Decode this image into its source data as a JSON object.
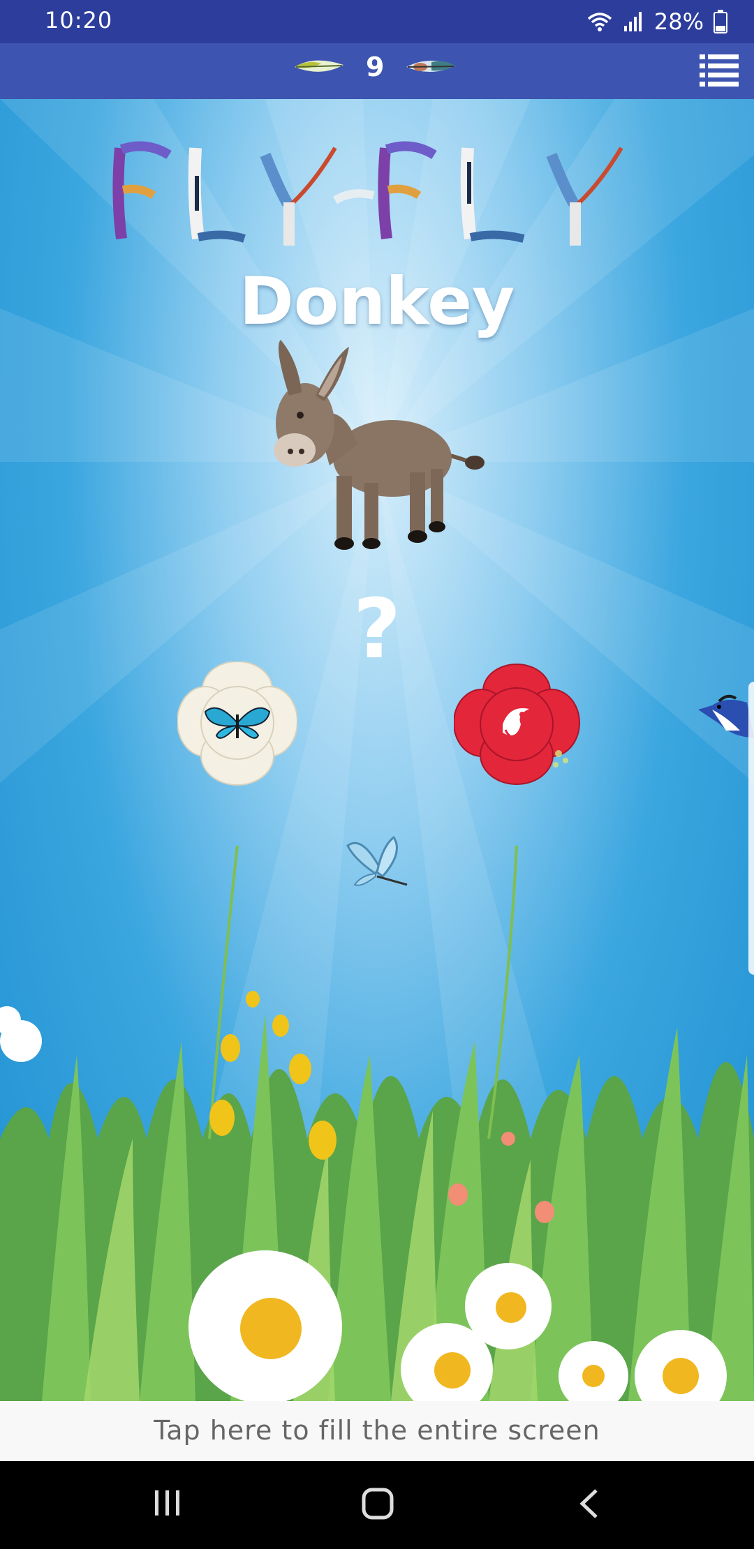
{
  "status_bar": {
    "time": "10:20",
    "battery_percent": "28%",
    "icons": [
      "wifi-icon",
      "signal-icon",
      "battery-icon"
    ]
  },
  "top_bar": {
    "score": "9",
    "icons": [
      "feather-left-icon",
      "feather-right-icon",
      "menu-list-icon"
    ]
  },
  "game": {
    "animal_name": "Donkey",
    "question": "?",
    "choices": [
      "butterfly-choice-icon",
      "bird-choice-icon"
    ]
  },
  "fullscreen_bar": {
    "text": "Tap here to fill the entire screen"
  },
  "nav_bar": {
    "icons": [
      "recent-apps-icon",
      "home-icon",
      "back-icon"
    ]
  },
  "colors": {
    "status_bar": "#2c3d9c",
    "top_bar": "#3d55b0",
    "sky": "#1f8fd0"
  }
}
